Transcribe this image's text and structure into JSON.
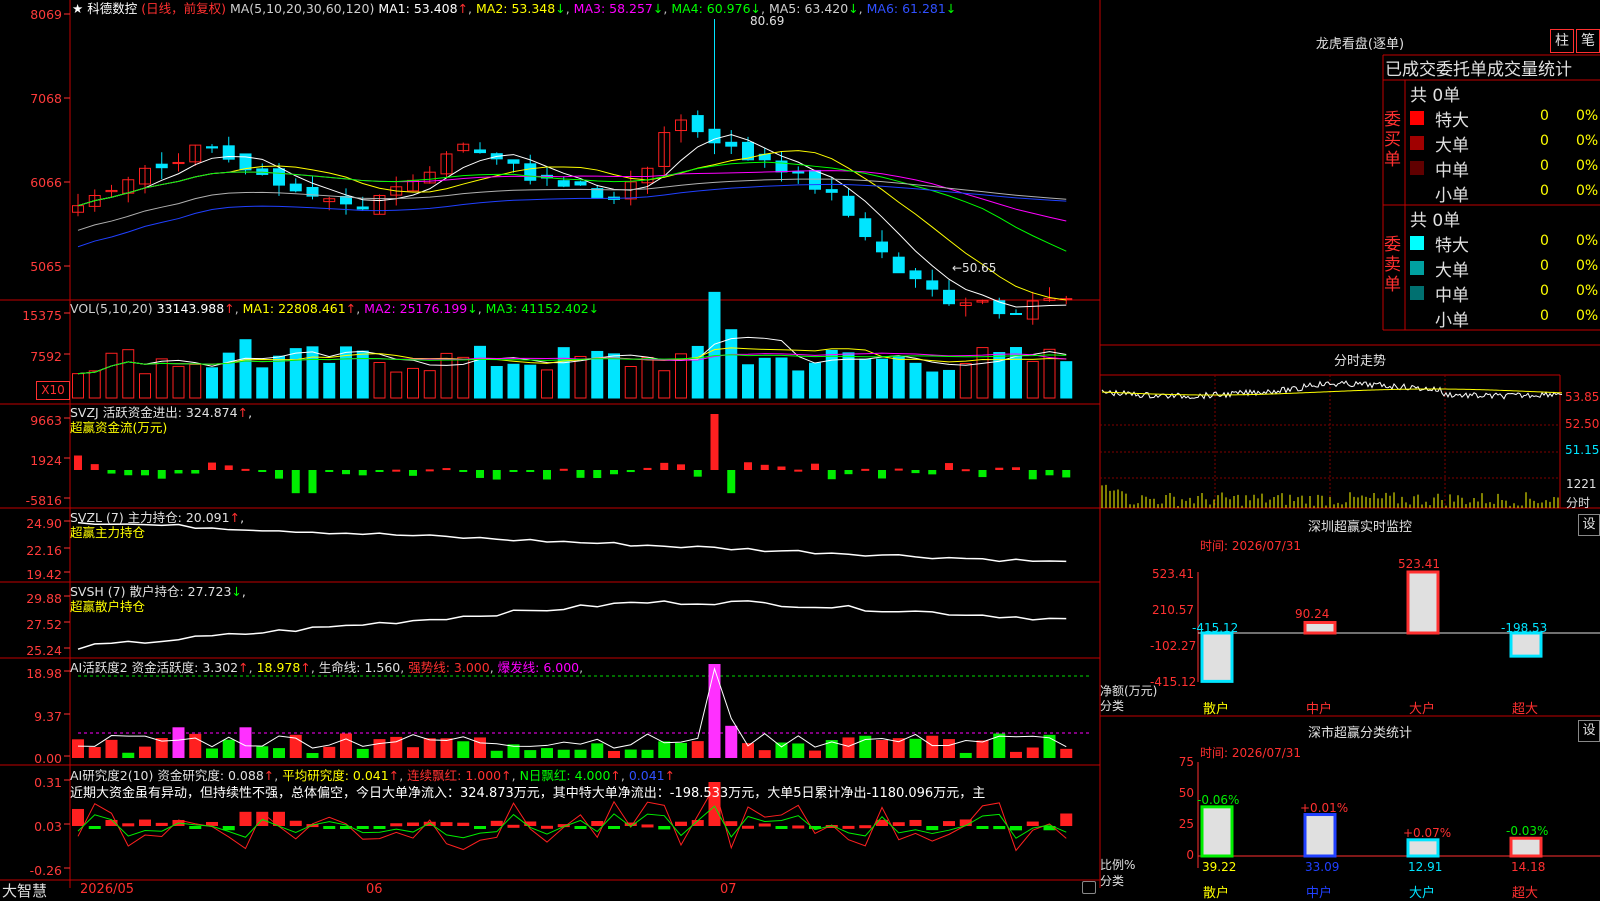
{
  "stock": {
    "star": "★",
    "name": "科德数控",
    "mode": "(日线，前复权)",
    "ma_label": "MA(5,10,20,30,60,120)",
    "ma1": "MA1: 53.408",
    "ma2": "MA2: 53.348",
    "ma3": "MA3: 58.257",
    "ma4": "MA4: 60.976",
    "ma5": "MA5: 63.420",
    "ma6": "MA6: 61.281",
    "y_labels": [
      "8069",
      "7068",
      "6066",
      "5065"
    ],
    "high_label": "80.69",
    "low_label": "←50.65",
    "colors": {
      "up": "#ff2020",
      "down": "#00e5ff",
      "ma1": "#ffffff",
      "ma2": "#ffff00",
      "ma3": "#ff00ff",
      "ma4": "#00ff00",
      "ma5": "#b0b0b0",
      "ma6": "#2040ff"
    }
  },
  "vol": {
    "label": "VOL(5,10,20)",
    "value": "33143.988",
    "ma1": "MA1: 22808.461",
    "ma2": "MA2: 25176.199",
    "ma3": "MA3: 41152.402",
    "y_labels": [
      "15375",
      "7592"
    ],
    "unit": "X10"
  },
  "svzj": {
    "label": "SVZJ  活跃资金进出: 324.874",
    "sub": "超赢资金流(万元)",
    "y_labels": [
      "9663",
      "1924",
      "-5816"
    ]
  },
  "svzl": {
    "label": "SVZL (7) 主力持仓: 20.091",
    "sub": "超赢主力持仓",
    "y_labels": [
      "24.90",
      "22.16",
      "19.42"
    ]
  },
  "svsh": {
    "label": "SVSH (7) 散户持仓: 27.723",
    "sub": "超赢散户持仓",
    "y_labels": [
      "29.88",
      "27.52",
      "25.24"
    ]
  },
  "ai_active": {
    "label": "AI活跃度2 资金活跃度: 3.302",
    "v2": "18.978",
    "life": "生命线: 1.560",
    "strong": "强势线: 3.000",
    "burst": "爆发线: 6.000",
    "y_labels": [
      "18.98",
      "9.37",
      "0.00"
    ]
  },
  "ai_research": {
    "label": "AI研究度2(10) 资金研究度: 0.088",
    "avg": "平均研究度: 0.041",
    "streak": "连续飘红: 1.000",
    "nday": "N日飘红: 4.000",
    "v5": "0.041",
    "comment": "近期大资金虽有异动，但持续性不强，总体偏空，今日大单净流入：324.873万元，其中特大单净流出：-198.533万元，大单5日累计净出-1180.096万元，主",
    "y_labels": [
      "0.31",
      "0.03",
      "-0.26"
    ]
  },
  "xaxis": {
    "brand": "大智慧",
    "labels": [
      "2026/05",
      "06",
      "07"
    ]
  },
  "dragon": {
    "title": "龙虎看盘(逐单)",
    "btn1": "柱",
    "btn2": "笔",
    "header": "已成交委托单成交量统计",
    "buy_side": "委买单",
    "sell_side": "委卖单",
    "buy_total": "共 0单",
    "sell_total": "共 0单",
    "buy_rows": [
      {
        "name": "特大",
        "count": "0",
        "pct": "0%",
        "color": "#ff0000"
      },
      {
        "name": "大单",
        "count": "0",
        "pct": "0%",
        "color": "#a00000"
      },
      {
        "name": "中单",
        "count": "0",
        "pct": "0%",
        "color": "#600000"
      },
      {
        "name": "小单",
        "count": "0",
        "pct": "0%",
        "color": "#000000"
      }
    ],
    "sell_rows": [
      {
        "name": "特大",
        "count": "0",
        "pct": "0%",
        "color": "#00ffff"
      },
      {
        "name": "大单",
        "count": "0",
        "pct": "0%",
        "color": "#00a0a0"
      },
      {
        "name": "中单",
        "count": "0",
        "pct": "0%",
        "color": "#007070"
      },
      {
        "name": "小单",
        "count": "0",
        "pct": "0%",
        "color": "#000000"
      }
    ]
  },
  "intraday": {
    "title": "分时走势",
    "y_labels": [
      "53.85",
      "52.50",
      "51.15"
    ],
    "vol_label": "1221",
    "unit": "分时"
  },
  "sz_monitor": {
    "title": "深圳超赢实时监控",
    "set": "设",
    "time": "时间: 2026/07/31",
    "y_labels": [
      "523.41",
      "210.57",
      "-102.27",
      "-415.12"
    ],
    "axis_unit": "净额(万元)",
    "axis_cat": "分类",
    "categories": [
      "散户",
      "中户",
      "大户",
      "超大"
    ],
    "values": [
      -415.12,
      90.24,
      523.41,
      -198.53
    ],
    "value_labels": [
      "-415.12",
      "90.24",
      "523.41",
      "-198.53"
    ]
  },
  "sz_class": {
    "title": "深市超赢分类统计",
    "set": "设",
    "time": "时间: 2026/07/31",
    "y_labels": [
      "75",
      "50",
      "25",
      "0"
    ],
    "axis_unit": "比例%",
    "axis_cat": "分类",
    "categories": [
      "散户",
      "中户",
      "大户",
      "超大"
    ],
    "values": [
      39.22,
      33.09,
      12.91,
      14.18
    ],
    "changes": [
      "-0.06%",
      "+0.01%",
      "+0.07%",
      "-0.03%"
    ]
  }
}
